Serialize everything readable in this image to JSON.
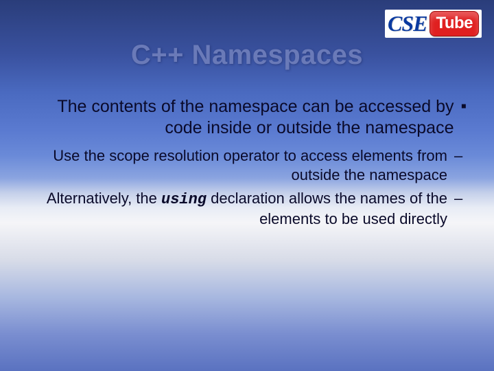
{
  "logo": {
    "cse": "CSE",
    "tube": "Tube"
  },
  "title": "C++ Namespaces",
  "bullets": {
    "square": "▪",
    "dash": "–"
  },
  "main_point": "The contents of the namespace can be accessed by code inside or outside the namespace",
  "sub_points": [
    {
      "pre": "Use the scope resolution operator to access elements from outside the namespace",
      "code": "",
      "post": ""
    },
    {
      "pre": "Alternatively, the ",
      "code": "using",
      "post": " declaration allows the names of the elements to be used directly"
    }
  ]
}
